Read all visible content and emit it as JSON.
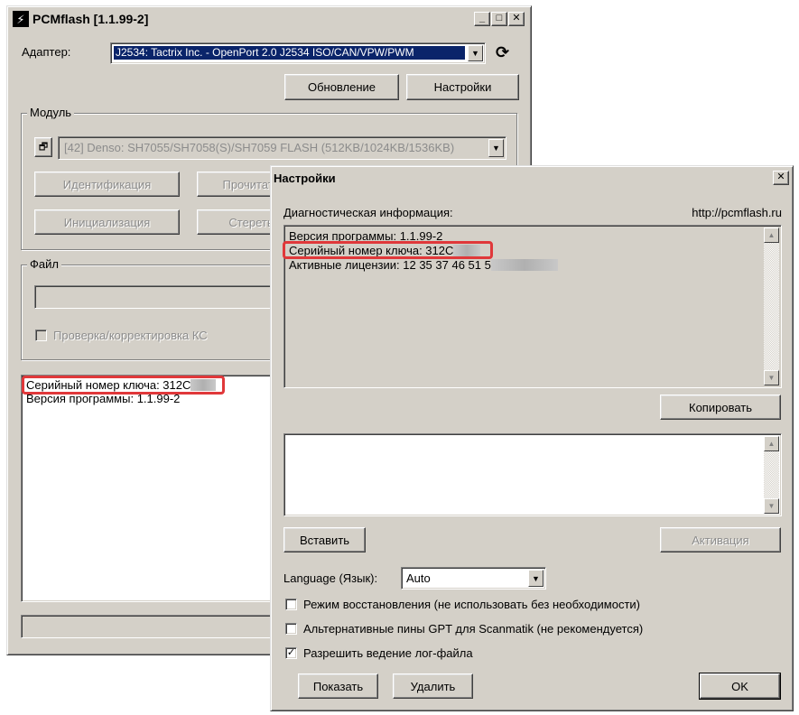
{
  "main_window": {
    "title": "PCMflash [1.1.99-2]",
    "icon": "lightning-icon",
    "adapter_label": "Адаптер:",
    "adapter_value": "J2534: Tactrix Inc. - OpenPort 2.0 J2534 ISO/CAN/VPW/PWM",
    "refresh_icon": "refresh-icon",
    "update_button": "Обновление",
    "settings_button": "Настройки",
    "module_group": "Модуль",
    "module_value": "[42] Denso: SH7055/SH7058(S)/SH7059 FLASH (512KB/1024KB/1536KB)",
    "identify_button": "Идентификация",
    "read_button": "Прочитать",
    "init_button": "Инициализация",
    "erase_button": "Стереть",
    "file_group": "Файл",
    "checksum_label": "Проверка/корректировка КС",
    "log_lines": [
      "Серийный номер ключа: 312C",
      "Версия программы: 1.1.99-2"
    ]
  },
  "settings_dialog": {
    "title": "Настройки",
    "diag_label": "Диагностическая информация:",
    "site": "http://pcmflash.ru",
    "info_lines": [
      "Версия программы: 1.1.99-2",
      "Серийный номер ключа: 312C",
      "Активные лицензии: 12 35 37 46 51 5"
    ],
    "copy_button": "Копировать",
    "paste_button": "Вставить",
    "activate_button": "Активация",
    "language_label": "Language (Язык):",
    "language_value": "Auto",
    "options": [
      {
        "label": "Режим восстановления (не использовать без необходимости)",
        "checked": false
      },
      {
        "label": "Альтернативные пины GPT для Scanmatik (не рекомендуется)",
        "checked": false
      },
      {
        "label": "Разрешить ведение лог-файла",
        "checked": true
      }
    ],
    "show_button": "Показать",
    "delete_button": "Удалить",
    "ok_button": "OK"
  },
  "colors": {
    "highlight": "#e0383a",
    "selection": "#0a246a",
    "face": "#d4d0c8"
  }
}
